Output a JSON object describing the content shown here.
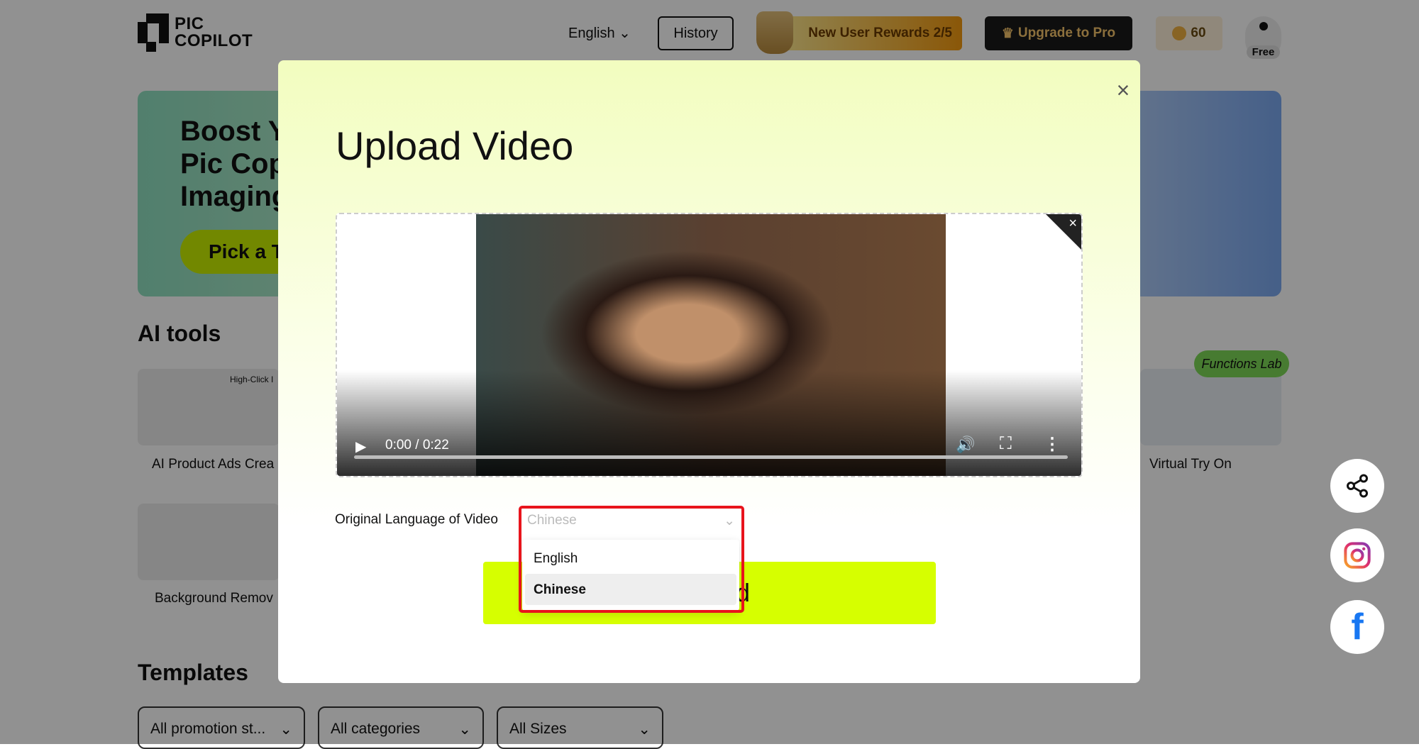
{
  "header": {
    "logo_line1": "PIC",
    "logo_line2": "COPILOT",
    "language": "English",
    "history": "History",
    "rewards": "New User Rewards 2/5",
    "upgrade": "Upgrade to Pro",
    "credits": "60",
    "plan": "Free"
  },
  "banner": {
    "line1": "Boost Y",
    "line2": "Pic Cop",
    "line3": "Imaging",
    "cta": "Pick a T"
  },
  "ai_tools": {
    "heading": "AI tools",
    "cards": [
      {
        "label": "AI Product Ads Crea",
        "thumb_text": "High-Click I"
      },
      {
        "label": "Background Remov"
      },
      {
        "label": "Virtual Try On",
        "badge": "Functions Lab"
      }
    ]
  },
  "templates": {
    "heading": "Templates",
    "filters": [
      "All promotion st...",
      "All categories",
      "All Sizes"
    ]
  },
  "side_icons": [
    "share-icon",
    "instagram-icon",
    "facebook-icon"
  ],
  "modal": {
    "title": "Upload Video",
    "video": {
      "current_time": "0:00",
      "separator": "/",
      "duration": "0:22",
      "progress": 0
    },
    "language_label": "Original Language of Video",
    "language_selected": "Chinese",
    "options": [
      "English",
      "Chinese"
    ],
    "highlighted_option": "Chinese",
    "upload_button": "Upload"
  },
  "colors": {
    "accent": "#d6ff00",
    "highlight_border": "#e8141c"
  }
}
